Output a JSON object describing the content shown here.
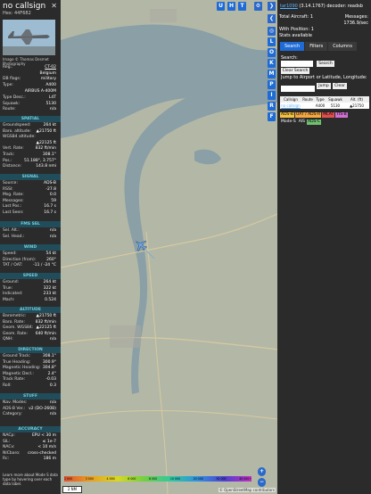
{
  "panel": {
    "callsign": "no callsign",
    "hex": "Hex: 44F682",
    "photo_credit": "Image © Thomas Desmet Photography",
    "reg_rows": [
      {
        "label": "Reg.:",
        "value": "CT-02",
        "link": true
      },
      {
        "label": "",
        "value": "Belgium",
        "link": false
      },
      {
        "label": "DB flags:",
        "value": "military",
        "link": false
      },
      {
        "label": "Type:",
        "value": "A400",
        "link": false
      }
    ],
    "aircraft_name": "AIRBUS A-400M",
    "type_rows": [
      {
        "label": "Type Desc.:",
        "value": "L4T"
      },
      {
        "label": "Squawk:",
        "value": "5130"
      },
      {
        "label": "Route:",
        "value": "n/a"
      }
    ],
    "sections": {
      "spatial": "SPATIAL",
      "signal": "SIGNAL",
      "fms": "FMS SEL",
      "wind": "WIND",
      "speed": "SPEED",
      "altitude": "ALTITUDE",
      "direction": "DIRECTION",
      "stuff": "STUFF",
      "accuracy": "ACCURACY"
    },
    "spatial_rows": [
      {
        "label": "Groundspeed:",
        "value": "264 kt"
      },
      {
        "label": "Baro. altitude:",
        "value": "▲21750 ft"
      },
      {
        "label": "WGS84 altitude:",
        "value": ""
      },
      {
        "label": "",
        "value": "▲22125 ft"
      },
      {
        "label": "Vert. Rate:",
        "value": "832 ft/min"
      },
      {
        "label": "Track:",
        "value": "308.1°"
      },
      {
        "label": "Pos.:",
        "value": "51.188°, 3.757°"
      },
      {
        "label": "Distance:",
        "value": "143.8 nmi"
      }
    ],
    "signal_rows": [
      {
        "label": "Source:",
        "value": "ADS-B"
      },
      {
        "label": "RSSI:",
        "value": "-27.8"
      },
      {
        "label": "Msg. Rate:",
        "value": "0.0"
      },
      {
        "label": "Messages:",
        "value": "59"
      },
      {
        "label": "Last Pos.:",
        "value": "16.7 s"
      },
      {
        "label": "Last Seen:",
        "value": "16.7 s"
      }
    ],
    "fms_rows": [
      {
        "label": "Sel. Alt.:",
        "value": "n/a"
      },
      {
        "label": "Sel. Head.:",
        "value": "n/a"
      }
    ],
    "wind_rows": [
      {
        "label": "Speed:",
        "value": "54 kt"
      },
      {
        "label": "Direction (from):",
        "value": "260°"
      },
      {
        "label": "TAT / OAT:",
        "value": "-11 / -24 °C"
      }
    ],
    "speed_rows": [
      {
        "label": "Ground:",
        "value": "264 kt"
      },
      {
        "label": "True:",
        "value": "322 kt"
      },
      {
        "label": "Indicated:",
        "value": "233 kt"
      },
      {
        "label": "Mach:",
        "value": "0.524"
      }
    ],
    "altitude_rows": [
      {
        "label": "Barometric:",
        "value": "▲21750 ft"
      },
      {
        "label": "Baro. Rate:",
        "value": "832 ft/min"
      },
      {
        "label": "Geom. WGS84:",
        "value": "▲22125 ft"
      },
      {
        "label": "Geom. Rate:",
        "value": "640 ft/min"
      },
      {
        "label": "QNH:",
        "value": "n/a"
      }
    ],
    "direction_rows": [
      {
        "label": "Ground Track:",
        "value": "308.1°"
      },
      {
        "label": "True Heading:",
        "value": "300.9°"
      },
      {
        "label": "Magnetic Heading:",
        "value": "304.8°"
      },
      {
        "label": "Magnetic Decl.:",
        "value": "2.4°"
      },
      {
        "label": "Track Rate:",
        "value": "-0.03"
      },
      {
        "label": "Roll:",
        "value": "0.3"
      }
    ],
    "stuff_rows": [
      {
        "label": "Nav. Modes:",
        "value": "n/a"
      },
      {
        "label": "ADS-B Ver.:",
        "value": "v2 (DO-260B)"
      },
      {
        "label": "Category:",
        "value": "n/a"
      }
    ],
    "accuracy_rows": [
      {
        "label": "NACp:",
        "value": "EPU < 30 m"
      },
      {
        "label": "SIL:",
        "value": "≤ 1e-7"
      },
      {
        "label": "NACv:",
        "value": "< 10 m/s"
      },
      {
        "label": "NICbaro:",
        "value": "cross-checked"
      },
      {
        "label": "Rc:",
        "value": "186 m"
      }
    ],
    "footer_note": "Learn more about Mode S data type by hovering over each data label."
  },
  "map": {
    "buttons": [
      "U",
      "H",
      "T"
    ],
    "side_buttons": [
      "L",
      "O",
      "K",
      "M",
      "P",
      "I",
      "R",
      "F"
    ],
    "zoom_in": "+",
    "zoom_out": "−",
    "attribution": "© OpenStreetMap contributors",
    "scale_label": "2 NM",
    "scale_ticks": [
      "2 000",
      "3 000",
      "4 000",
      "6 000",
      "8 000",
      "10 000",
      "20 000",
      "30 000",
      "40 000+"
    ],
    "colors": {
      "land": "#b3b8a6",
      "water": "#8a9fa6",
      "road": "#d7c9a0",
      "aircraft": "#6fa6e0"
    }
  },
  "right": {
    "title_link": "tar1090",
    "title_rest": "(3.14.1767) decoder: readsb",
    "stats": [
      {
        "label": "Total Aircraft:",
        "value": "1"
      },
      {
        "label": "Messages:",
        "value": "1736.9/sec"
      },
      {
        "label": "With Position:",
        "value": "1"
      },
      {
        "label": "Stats available",
        "value": ""
      }
    ],
    "tabs": [
      "Search",
      "Filters",
      "Columns"
    ],
    "search_label": "Search:",
    "search_button": "Search",
    "clear_search": "Clear Search",
    "jump_label": "Jump to Airport or Latitude, Longitude:",
    "jump_button": "Jump",
    "clear_button": "Clear",
    "table_headers": [
      "Callsign",
      "Route",
      "Type",
      "Squawk",
      "Alt. (ft)"
    ],
    "table_row": [
      "no callsign",
      "",
      "A400",
      "5130",
      "▲21750"
    ],
    "badges_row1": [
      "ADS-B",
      "UAT / ADS-R",
      "MLAT",
      "TIS-B"
    ],
    "badges_row2": [
      "Mode-S",
      "AIS",
      "ADS-C"
    ]
  }
}
